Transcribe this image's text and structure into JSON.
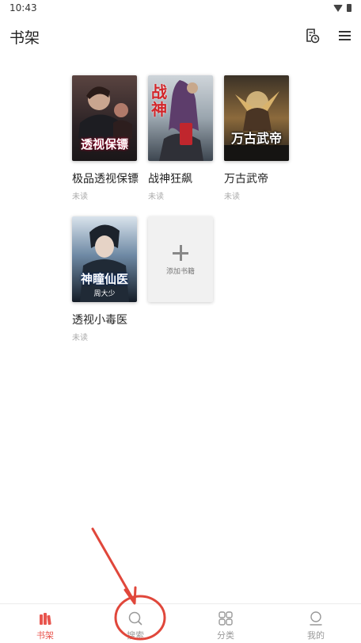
{
  "status_bar": {
    "time": "10:43"
  },
  "header": {
    "title": "书架"
  },
  "books": [
    {
      "title": "极品透视保镖",
      "status": "未读",
      "cover_text": "透视保镖",
      "cover_color": "#3a2a2a"
    },
    {
      "title": "战神狂飙",
      "status": "未读",
      "cover_text": "战神",
      "cover_color": "#7a3b3b"
    },
    {
      "title": "万古武帝",
      "status": "未读",
      "cover_text": "万古武帝",
      "cover_color": "#5a3d22"
    },
    {
      "title": "透视小毒医",
      "status": "未读",
      "cover_text": "神瞳仙医",
      "cover_color": "#223344"
    }
  ],
  "cover_sub": {
    "author": "周大少"
  },
  "add_book": {
    "label": "添加书籍"
  },
  "bottom_nav": [
    {
      "label": "书架",
      "icon": "bookshelf-icon"
    },
    {
      "label": "搜索",
      "icon": "search-icon"
    },
    {
      "label": "分类",
      "icon": "grid-icon"
    },
    {
      "label": "我的",
      "icon": "profile-icon"
    }
  ],
  "colors": {
    "accent": "#e8554e",
    "annotation": "#e0473b"
  }
}
